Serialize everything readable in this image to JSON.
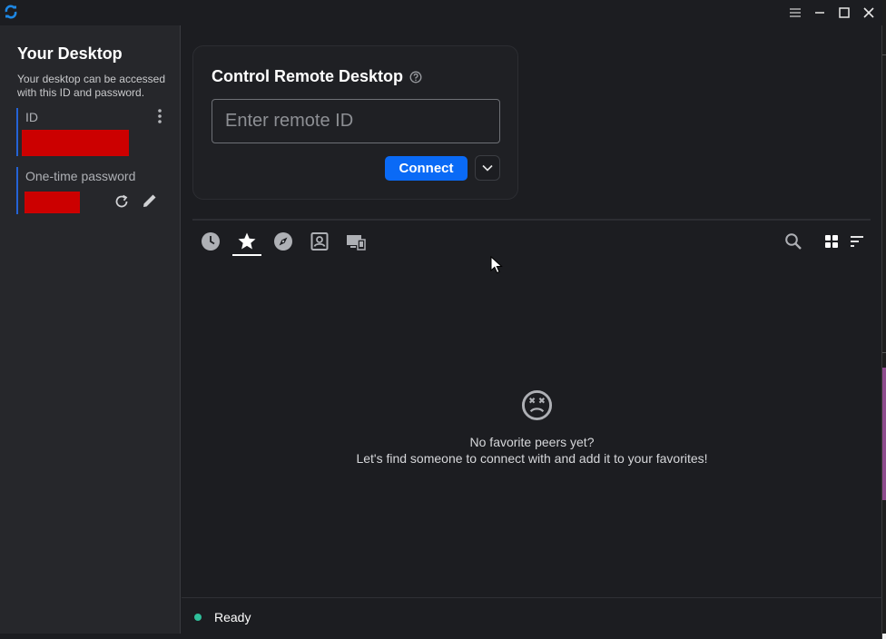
{
  "titlebar": {
    "app_icon": "rustdesk-logo",
    "buttons": [
      "menu-icon",
      "minimize-icon",
      "maximize-icon",
      "close-icon"
    ]
  },
  "sidebar": {
    "title": "Your Desktop",
    "description": "Your desktop can be accessed with this ID and password.",
    "id_label": "ID",
    "password_label": "One-time password",
    "accent_color": "#2463d6",
    "redaction_color": "#cc0000"
  },
  "connect_card": {
    "title": "Control Remote Desktop",
    "input_placeholder": "Enter remote ID",
    "input_value": "",
    "connect_label": "Connect",
    "button_color": "#0a6af6"
  },
  "tabs": [
    {
      "name": "recent",
      "icon": "clock-icon",
      "active": false
    },
    {
      "name": "favorites",
      "icon": "star-icon",
      "active": true
    },
    {
      "name": "discovered",
      "icon": "compass-icon",
      "active": false
    },
    {
      "name": "address-book",
      "icon": "contact-book-icon",
      "active": false
    },
    {
      "name": "group",
      "icon": "devices-icon",
      "active": false
    }
  ],
  "toolbar_icons": [
    "search-icon",
    "grid-view-icon",
    "sort-icon"
  ],
  "empty_state": {
    "icon": "sad-face-icon",
    "line1": "No favorite peers yet?",
    "line2": "Let's find someone to connect with and add it to your favorites!"
  },
  "status": {
    "text": "Ready",
    "dot_color": "#2fbf9a"
  }
}
